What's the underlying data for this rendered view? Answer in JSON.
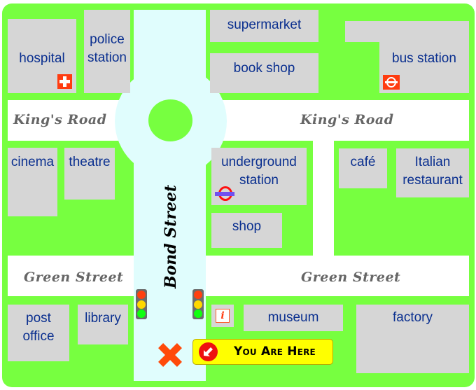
{
  "map": {
    "roads": {
      "kings_road_left": "King's Road",
      "kings_road_right": "King's Road",
      "green_street_left": "Green Street",
      "green_street_right": "Green Street",
      "bond_street": "Bond Street"
    },
    "places": {
      "hospital": "hospital",
      "police_station_1": "police",
      "police_station_2": "station",
      "supermarket": "supermarket",
      "book_shop": "book shop",
      "bus_station": "bus station",
      "cinema": "cinema",
      "theatre": "theatre",
      "underground_1": "underground",
      "underground_2": "station",
      "shop": "shop",
      "cafe": "café",
      "italian_1": "Italian",
      "italian_2": "restaurant",
      "post_office_1": "post",
      "post_office_2": "office",
      "library": "library",
      "museum": "museum",
      "factory": "factory"
    },
    "you_are_here": "You Are Here",
    "icons": {
      "hospital": "first-aid-cross",
      "bus": "bus-roundel",
      "underground": "underground-roundel",
      "info": "information",
      "traffic_light": "traffic-light",
      "marker": "x-marker",
      "arrow": "arrow-down-left"
    },
    "colors": {
      "grass": "#77ff40",
      "block": "#d6d6d6",
      "label": "#0a2f8f",
      "bond_street": "#e0fdfd",
      "road": "#ffffff",
      "marker": "#ff4a0a",
      "banner": "#ffff00"
    }
  }
}
